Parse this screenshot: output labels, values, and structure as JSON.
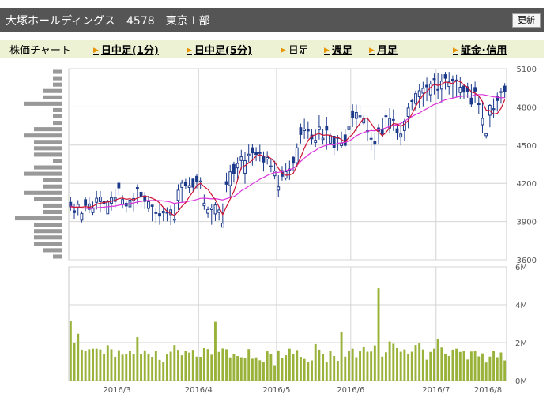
{
  "header": {
    "title": "大塚ホールディングス　4578　東京１部",
    "update_label": "更新"
  },
  "tabs": [
    {
      "label": "株価チャート",
      "link": false,
      "arrow": false,
      "x": 12
    },
    {
      "label": "日中足(1分)",
      "link": true,
      "arrow": true,
      "x": 118
    },
    {
      "label": "日中足(5分)",
      "link": true,
      "arrow": true,
      "x": 236
    },
    {
      "label": "日足",
      "link": false,
      "arrow": true,
      "x": 355
    },
    {
      "label": "週足",
      "link": true,
      "arrow": true,
      "x": 410
    },
    {
      "label": "月足",
      "link": true,
      "arrow": true,
      "x": 467
    },
    {
      "label": "証金･信用",
      "link": true,
      "arrow": true,
      "x": 573
    }
  ],
  "colors": {
    "candle_up": "#1c3a8c",
    "candle_down": "#1c3a8c",
    "ma_short": "#cc1133",
    "ma_long": "#dd33dd",
    "volume": "#99b33a",
    "volume_profile": "#999999",
    "grid": "#d4d4d4"
  },
  "chart_data": [
    {
      "type": "candlestick",
      "title": "",
      "yticks": [
        5100,
        4800,
        4500,
        4200,
        3900,
        3600
      ],
      "ylim": [
        3600,
        5100
      ],
      "xticks": [
        "2016/3",
        "2016/4",
        "2016/5",
        "2016/6",
        "2016/7",
        "2016/8"
      ],
      "series": [
        {
          "values": [
            4051,
            3985,
            4009,
            3911,
            4072,
            3996,
            3970,
            4051,
            4056,
            4056,
            3961,
            4043,
            4058,
            4201,
            4037,
            4043,
            4015,
            4062,
            4167,
            4130,
            4102,
            4003,
            4029,
            3968,
            3962,
            3968,
            3974,
            3954,
            3911,
            4067,
            4168,
            4211,
            4167,
            4233,
            4255,
            4210,
            4024,
            3965,
            3994,
            3960,
            3971,
            3856,
            4213,
            4182,
            4348,
            4321,
            4379,
            4279,
            4419,
            4479,
            4443,
            4443,
            4413,
            4390,
            4329,
            4259,
            4146,
            4300,
            4240,
            4304,
            4404,
            4362,
            4637,
            4614,
            4622,
            4579,
            4520,
            4621,
            4544,
            4650,
            4515,
            4570,
            4559,
            4496,
            4580,
            4621,
            4769,
            4709,
            4722,
            4674,
            4605,
            4548,
            4527,
            4635,
            4619,
            4724,
            4634,
            4701,
            4628,
            4563,
            4614,
            4725,
            4844,
            4827,
            4880,
            4908,
            4970,
            4895,
            5022,
            4935,
            4940,
            5053,
            4960,
            5017,
            5011,
            4913,
            4964,
            4957,
            4869,
            4952,
            4824,
            4660,
            4574,
            4734,
            4779,
            4880,
            4920,
            4963
          ]
        },
        {
          "values": [
            4094,
            4041,
            4068,
            3981,
            4095,
            4091,
            4057,
            4140,
            4140,
            4069,
            4071,
            4136,
            4154,
            4213,
            4107,
            4058,
            4144,
            4125,
            4192,
            4145,
            4132,
            4102,
            4031,
            4002,
            4050,
            4011,
            4012,
            4025,
            4042,
            4193,
            4227,
            4235,
            4249,
            4238,
            4276,
            4248,
            4112,
            4018,
            4036,
            4052,
            4015,
            4042,
            4283,
            4345,
            4370,
            4404,
            4463,
            4447,
            4504,
            4508,
            4484,
            4503,
            4451,
            4453,
            4389,
            4377,
            4263,
            4336,
            4356,
            4378,
            4417,
            4514,
            4669,
            4707,
            4687,
            4629,
            4621,
            4734,
            4625,
            4722,
            4589,
            4575,
            4579,
            4606,
            4623,
            4716,
            4820,
            4818,
            4812,
            4731,
            4718,
            4603,
            4598,
            4665,
            4715,
            4777,
            4790,
            4781,
            4660,
            4673,
            4705,
            4832,
            4865,
            4928,
            4982,
            4997,
            5030,
            5008,
            5061,
            5064,
            5056,
            5075,
            5074,
            5047,
            5052,
            5037,
            4978,
            4990,
            4981,
            4998,
            4886,
            4847,
            4598,
            4821,
            4867,
            4912,
            4949,
            4987
          ]
        },
        {
          "values": [
            3985,
            3919,
            3950,
            3893,
            3982,
            3965,
            3952,
            3994,
            3970,
            3985,
            3959,
            3986,
            4006,
            4101,
            4002,
            3970,
            3982,
            3981,
            4039,
            4005,
            3997,
            3973,
            3902,
            3888,
            3875,
            3903,
            3902,
            3873,
            3884,
            3991,
            4052,
            4158,
            4126,
            4138,
            4160,
            4154,
            3992,
            3930,
            3875,
            3904,
            3908,
            3853,
            4131,
            4085,
            4206,
            4225,
            4309,
            4197,
            4366,
            4339,
            4374,
            4371,
            4293,
            4347,
            4287,
            4232,
            4090,
            4221,
            4224,
            4227,
            4296,
            4325,
            4513,
            4549,
            4549,
            4502,
            4486,
            4543,
            4504,
            4464,
            4505,
            4423,
            4457,
            4480,
            4487,
            4558,
            4642,
            4612,
            4645,
            4658,
            4531,
            4459,
            4381,
            4510,
            4566,
            4593,
            4597,
            4611,
            4543,
            4498,
            4532,
            4633,
            4776,
            4772,
            4790,
            4805,
            4845,
            4839,
            4897,
            4862,
            4835,
            4935,
            4897,
            4868,
            4878,
            4865,
            4862,
            4871,
            4802,
            4829,
            4741,
            4598,
            4552,
            4640,
            4712,
            4763,
            4825,
            4871
          ]
        },
        {
          "values": [
            4016,
            3970,
            4034,
            3963,
            4026,
            4038,
            4008,
            4083,
            4093,
            4040,
            4058,
            4087,
            4089,
            4164,
            4073,
            4022,
            4068,
            4081,
            4155,
            4099,
            4058,
            4056,
            4019,
            3970,
            3943,
            3981,
            3966,
            3992,
            3919,
            4146,
            4201,
            4183,
            4183,
            4170,
            4212,
            4218,
            4044,
            3994,
            4006,
            4030,
            3991,
            3887,
            4193,
            4290,
            4278,
            4356,
            4408,
            4378,
            4429,
            4439,
            4427,
            4435,
            4367,
            4403,
            4336,
            4296,
            4172,
            4255,
            4291,
            4312,
            4358,
            4479,
            4583,
            4626,
            4611,
            4549,
            4538,
            4642,
            4554,
            4618,
            4575,
            4479,
            4556,
            4516,
            4498,
            4650,
            4713,
            4756,
            4730,
            4709,
            4613,
            4553,
            4507,
            4609,
            4589,
            4730,
            4709,
            4698,
            4601,
            4587,
            4688,
            4791,
            4849,
            4904,
            4927,
            4945,
            4957,
            4980,
            5014,
            4937,
            5002,
            5025,
            4996,
            5003,
            5005,
            4954,
            4916,
            4921,
            4822,
            4924,
            4819,
            4710,
            4590,
            4812,
            4786,
            4850,
            4918,
            4920
          ]
        },
        {
          "values": [
            4016,
            4012,
            4014,
            4012,
            4018,
            4012,
            4019,
            4037,
            4044,
            4050,
            4053,
            4059,
            4067,
            4080,
            4085,
            4075,
            4079,
            4070,
            4085,
            4094,
            4101,
            4094,
            4082,
            4069,
            4045,
            4011,
            3980,
            3964,
            3946,
            3980,
            4020,
            4049,
            4095,
            4135,
            4183,
            4200,
            4174,
            4152,
            4111,
            4072,
            4015,
            3954,
            4016,
            4076,
            4137,
            4226,
            4325,
            4338,
            4360,
            4382,
            4414,
            4425,
            4413,
            4416,
            4395,
            4367,
            4318,
            4280,
            4263,
            4265,
            4278,
            4339,
            4403,
            4476,
            4536,
            4570,
            4582,
            4591,
            4577,
            4580,
            4576,
            4558,
            4561,
            4544,
            4525,
            4561,
            4584,
            4630,
            4672,
            4711,
            4712,
            4671,
            4626,
            4605,
            4574,
            4598,
            4637,
            4669,
            4665,
            4647,
            4665,
            4693,
            4744,
            4804,
            4852,
            4895,
            4920,
            4952,
            4980,
            4968,
            4978,
            4995,
            4990,
            4982,
            5006,
            4998,
            4973,
            4954,
            4917,
            4907,
            4886,
            4840,
            4774,
            4770,
            4743,
            4749,
            4789,
            4857
          ]
        },
        {
          "values": [
            4022,
            4013,
            4008,
            4006,
            4005,
            4002,
            4003,
            4008,
            4011,
            4013,
            4016,
            4019,
            4021,
            4028,
            4032,
            4035,
            4041,
            4046,
            4054,
            4058,
            4063,
            4066,
            4065,
            4066,
            4064,
            4062,
            4058,
            4052,
            4042,
            4048,
            4050,
            4054,
            4060,
            4065,
            4073,
            4082,
            4083,
            4081,
            4078,
            4080,
            4075,
            4070,
            4079,
            4089,
            4096,
            4116,
            4142,
            4158,
            4177,
            4197,
            4213,
            4232,
            4246,
            4262,
            4274,
            4284,
            4286,
            4292,
            4299,
            4309,
            4315,
            4341,
            4372,
            4398,
            4422,
            4444,
            4458,
            4479,
            4489,
            4500,
            4505,
            4502,
            4514,
            4518,
            4522,
            4532,
            4550,
            4574,
            4587,
            4599,
            4609,
            4614,
            4613,
            4620,
            4626,
            4636,
            4646,
            4653,
            4660,
            4671,
            4686,
            4708,
            4724,
            4740,
            4752,
            4771,
            4786,
            4804,
            4819,
            4828,
            4844,
            4856,
            4863,
            4869,
            4877,
            4882,
            4885,
            4887,
            4885,
            4894,
            4897,
            4897,
            4892,
            4885,
            4879,
            4876,
            4871,
            4873
          ]
        }
      ]
    },
    {
      "type": "bar",
      "title": "",
      "yticks": [
        "6M",
        "4M",
        "2M",
        "0M"
      ],
      "ylim": [
        0,
        6000000
      ],
      "values": [
        3150000,
        2000000,
        2470000,
        1630000,
        1580000,
        1650000,
        1680000,
        1680000,
        1640000,
        1380000,
        1860000,
        1650000,
        1250000,
        1600000,
        1360000,
        1380000,
        1580000,
        1400000,
        2290000,
        1390000,
        1590000,
        1420000,
        1250000,
        1570000,
        1090000,
        990000,
        1370000,
        1520000,
        1870000,
        1620000,
        1330000,
        1560000,
        1470000,
        1620000,
        1260000,
        1250000,
        1710000,
        1660000,
        1360000,
        3100000,
        1510000,
        1690000,
        1650000,
        1220000,
        1380000,
        1290000,
        1230000,
        1180000,
        1660000,
        1150000,
        1220000,
        1070000,
        1000000,
        1540000,
        1380000,
        810000,
        1590000,
        1210000,
        1330000,
        1680000,
        1410000,
        1610000,
        1250000,
        1140000,
        990000,
        1060000,
        1920000,
        1630000,
        1380000,
        980000,
        1580000,
        1290000,
        1040000,
        2580000,
        1260000,
        1560000,
        1680000,
        1230000,
        1570000,
        1790000,
        1520000,
        1530000,
        1850000,
        4870000,
        1260000,
        1490000,
        2060000,
        1940000,
        1710000,
        1520000,
        1640000,
        1390000,
        1520000,
        1870000,
        2000000,
        1640000,
        1100000,
        1510000,
        1680000,
        2200000,
        1740000,
        1380000,
        1290000,
        1630000,
        1680000,
        1510000,
        1570000,
        1110000,
        1530000,
        1570000,
        1270000,
        1430000,
        950000,
        1260000,
        1560000,
        1230000,
        1480000,
        1060000
      ]
    }
  ],
  "volume_profile": [
    1,
    1,
    1,
    2,
    2,
    4,
    1,
    1,
    1,
    3,
    4,
    3,
    3,
    3,
    1,
    3,
    4,
    2,
    2,
    4,
    3,
    2,
    2,
    5,
    3,
    3,
    3,
    3,
    2,
    1
  ]
}
